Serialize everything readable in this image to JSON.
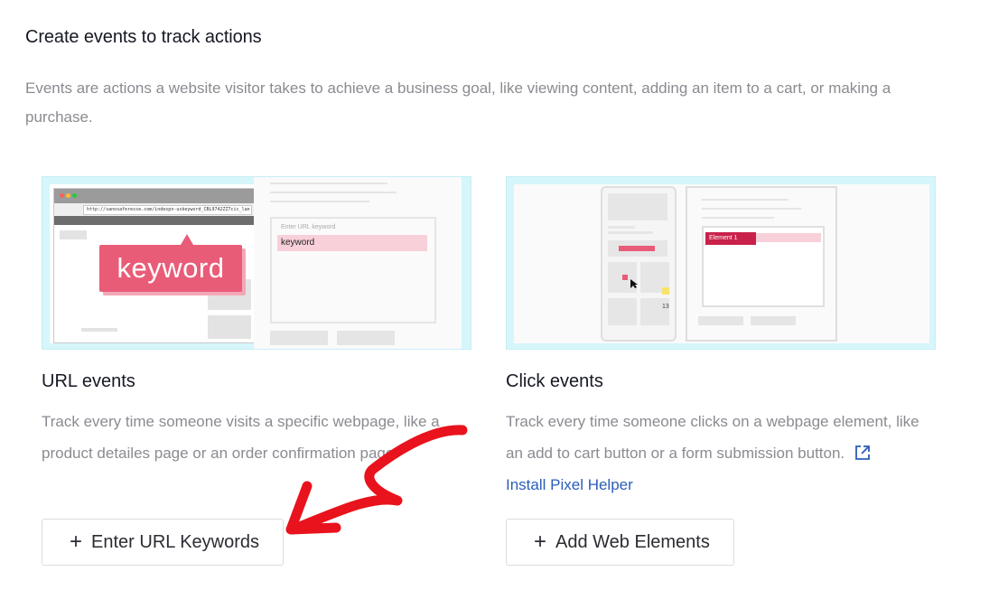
{
  "header": {
    "title": "Create events to track actions",
    "description": "Events are actions a website visitor takes to achieve a business goal, like viewing content, adding an item to a cart, or making a purchase."
  },
  "url_card": {
    "title": "URL events",
    "description": "Track every time someone visits a specific webpage, like a product detailes page or an order confirmation page.",
    "button_label": "Enter URL Keywords",
    "illustration": {
      "address_text": "http://sanosaferesse.com/indexpn-uskeyword_CBL9742ZZ7cic_lan",
      "keyword_bubble": "keyword",
      "field_label": "Enter URL keyword",
      "field_value": "keyword"
    }
  },
  "click_card": {
    "title": "Click events",
    "description": "Track every time someone clicks on a webpage element, like an add to cart button or a form submission button.",
    "help_link": "Install Pixel Helper",
    "button_label": "Add Web Elements",
    "illustration": {
      "element_tag": "Element 1",
      "counter": "13"
    }
  },
  "colors": {
    "accent_pink": "#e95c78",
    "illustration_bg": "#d6f6fb",
    "link_blue": "#2b5db9",
    "annotation_red": "#e8131c"
  },
  "icons": {
    "plus": "plus-icon",
    "external_link": "external-link-icon"
  }
}
